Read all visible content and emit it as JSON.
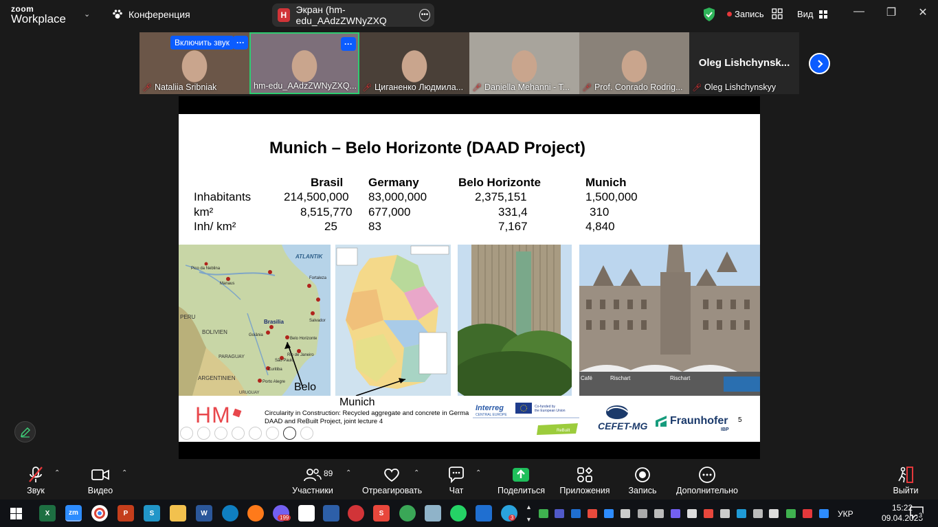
{
  "app": {
    "logo_line1": "zoom",
    "logo_line2": "Workplace",
    "meeting_label": "Конференция"
  },
  "screen_share": {
    "badge": "H",
    "title": "Экран (hm-edu_AAdzZWNyZXQ"
  },
  "recording": {
    "label": "Запись"
  },
  "view": {
    "label": "Вид"
  },
  "participants": [
    {
      "name": "Nataliia Sribniak",
      "unmute_label": "Включить звук",
      "bg": "#6b5648"
    },
    {
      "name": "hm-edu_AAdzZWNyZXQ...",
      "bg": "#7d6f7a"
    },
    {
      "name": "Циганенко Людмила...",
      "bg": "#4a4038"
    },
    {
      "name": "Daniella Mehanni - T...",
      "bg": "#a8a49c"
    },
    {
      "name": "Prof. Conrado Rodrig...",
      "bg": "#8a8279"
    },
    {
      "name": "Oleg Lishchynskyy",
      "tile_name": "Oleg  Lishchynsk...",
      "bg": "#262626"
    }
  ],
  "slide": {
    "title": "Munich – Belo Horizonte (DAAD Project)",
    "headers": [
      "Brasil",
      "Germany",
      "Belo Horizonte",
      "Munich"
    ],
    "rows": [
      {
        "label": "Inhabitants",
        "values": [
          "214,500,000",
          "83,000,000",
          "2,375,151",
          "1,500,000"
        ]
      },
      {
        "label": "km²",
        "values": [
          "8,515,770",
          "677,000",
          "331,4",
          "310"
        ]
      },
      {
        "label": "Inh/ km²",
        "values": [
          "25",
          "83",
          "7,167",
          "4,840"
        ]
      }
    ],
    "map_labels": {
      "atlantik": "ATLANTIK",
      "peru": "PERU",
      "bolivien": "BOLIVIEN",
      "paraguay": "PARAGUAY",
      "argentinien": "ARGENTINIEN",
      "brasilia": "Brasilia",
      "belo_horizonte": "Belo Horizonte",
      "manaus": "Manaus",
      "fortaleza": "Fortaleza",
      "salvador": "Salvador",
      "sao_paulo": "São Paulo",
      "rio": "Rio de Janeiro",
      "curitiba": "Curitiba",
      "porto_alegre": "Porto Alegre",
      "goiania": "Goiânia",
      "neblina": "Pico da Neblina",
      "uruguay": "URUGUAY"
    },
    "caption_belo": "Belo",
    "caption_munich": "Munich",
    "footer_line1": "Circularity in Construction: Recycled aggregate and concrete in Germa",
    "footer_line2": "DAAD and ReBuilt Project, joint lecture 4",
    "hm_logo": "HM",
    "interreg": {
      "name": "Interreg",
      "region": "CENTRAL EUROPE",
      "cofund1": "Co-funded by",
      "cofund2": "the European Union",
      "rebuilt": "ReBuilt"
    },
    "cefet": "CEFET-MG",
    "fraunhofer": "Fraunhofer",
    "fraunhofer_sub": "IBP",
    "page": "5",
    "munich_signs": {
      "cafe": "Café",
      "rischart": "Rischart",
      "rischart2": "Rischart"
    }
  },
  "toolbar": {
    "audio": "Звук",
    "video": "Видео",
    "participants": "Участники",
    "participants_count": "89",
    "react": "Отреагировать",
    "chat": "Чат",
    "share": "Поделиться",
    "apps": "Приложения",
    "record": "Запись",
    "more": "Дополнительно",
    "leave": "Выйти"
  },
  "taskbar": {
    "viber_badge": "199",
    "telegram_badge": "3",
    "zoom_label": "zm",
    "excel": "X",
    "word": "W",
    "powerpoint": "P",
    "lang": "УКР",
    "time": "15:22",
    "date": "09.04.2025",
    "notifications": "3"
  }
}
